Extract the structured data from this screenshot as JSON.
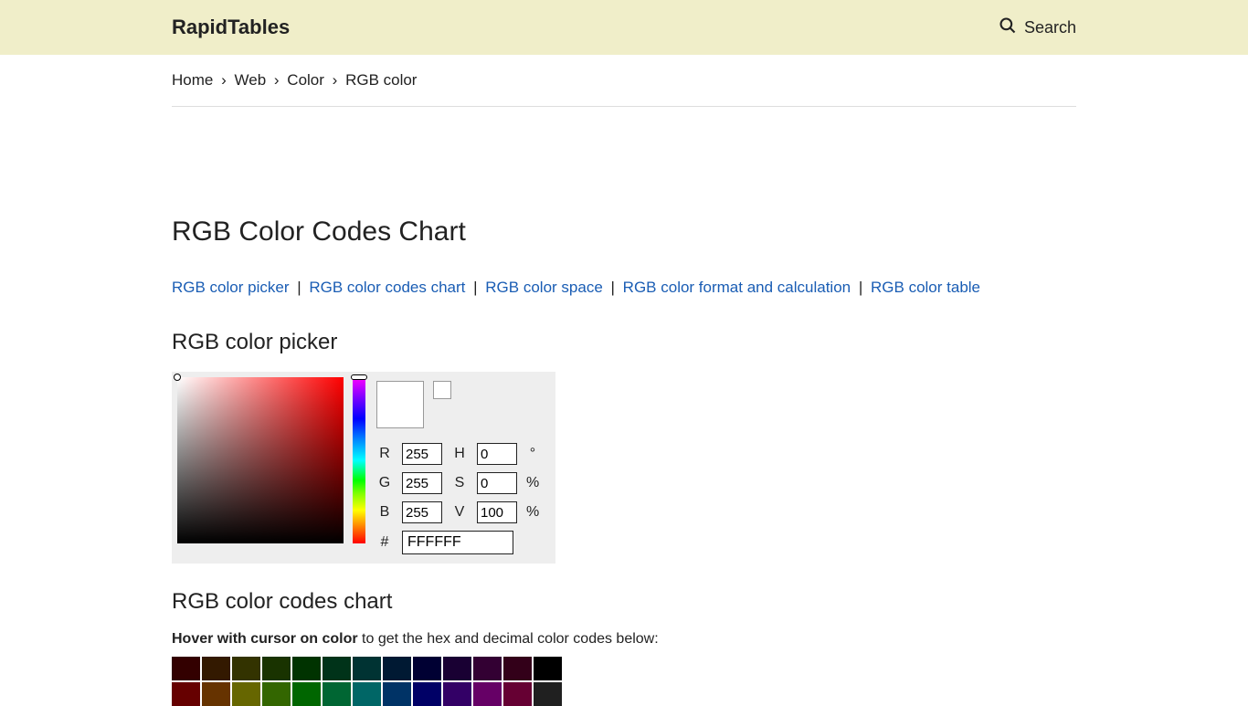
{
  "header": {
    "logo": "RapidTables",
    "search_label": "Search"
  },
  "breadcrumb": {
    "items": [
      "Home",
      "Web",
      "Color",
      "RGB color"
    ],
    "sep": "›"
  },
  "page_title": "RGB Color Codes Chart",
  "anchors": {
    "links": [
      "RGB color picker",
      "RGB color codes chart",
      "RGB color space",
      "RGB color format and calculation",
      "RGB color table"
    ],
    "pipe": "|"
  },
  "section_picker": "RGB color picker",
  "picker": {
    "R_label": "R",
    "R": "255",
    "G_label": "G",
    "G": "255",
    "B_label": "B",
    "B": "255",
    "H_label": "H",
    "H": "0",
    "H_unit": "°",
    "S_label": "S",
    "S": "0",
    "S_unit": "%",
    "V_label": "V",
    "V": "100",
    "V_unit": "%",
    "hash": "#",
    "hex": "FFFFFF",
    "swatch_main": "#ffffff",
    "swatch_prev": "#ffffff"
  },
  "section_chart": "RGB color codes chart",
  "hover": {
    "bold": "Hover with cursor on color",
    "rest": " to get the hex and decimal color codes below:"
  },
  "grid_rows": [
    [
      "#330000",
      "#331900",
      "#333300",
      "#193300",
      "#003300",
      "#003319",
      "#003333",
      "#001933",
      "#000033",
      "#190033",
      "#330033",
      "#330019",
      "#000000"
    ],
    [
      "#660000",
      "#663300",
      "#666600",
      "#336600",
      "#006600",
      "#006633",
      "#006666",
      "#003366",
      "#000066",
      "#330066",
      "#660066",
      "#660033",
      "#202020"
    ]
  ]
}
